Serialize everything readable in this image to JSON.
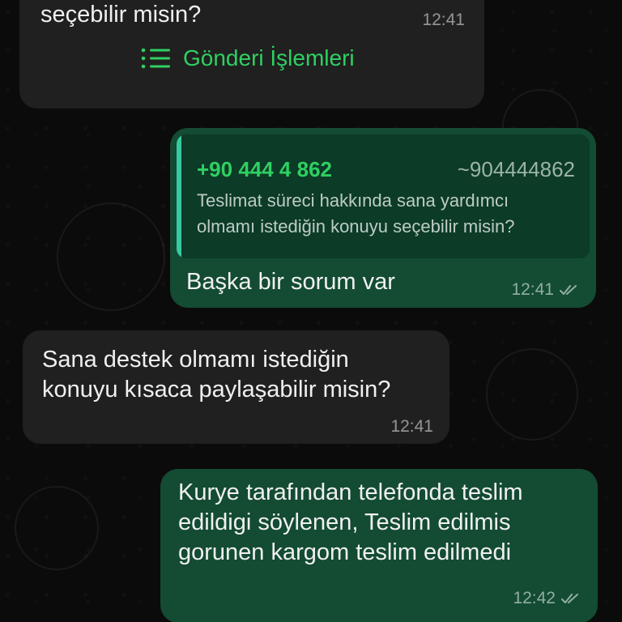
{
  "messages": [
    {
      "direction": "incoming",
      "text": "seçebilir misin?",
      "time": "12:41",
      "action": {
        "icon": "list-icon",
        "label": "Gönderi İşlemleri"
      }
    },
    {
      "direction": "outgoing",
      "quote": {
        "author": "+90 444 4 862",
        "phone": "~904444862",
        "text": "Teslimat süreci hakkında sana yardımcı\nolmamı istediğin konuyu seçebilir misin?"
      },
      "text": "Başka bir sorum var",
      "time": "12:41",
      "status": "double-check-icon"
    },
    {
      "direction": "incoming",
      "text": "Sana destek olmamı istediğin\nkonuyu kısaca paylaşabilir misin?",
      "time": "12:41"
    },
    {
      "direction": "outgoing",
      "text": "Kurye tarafından telefonda teslim\nedildigi söylenen, Teslim edilmis\ngorunen kargom teslim edilmedi",
      "time": "12:42",
      "status": "double-check-icon"
    }
  ],
  "colors": {
    "background": "#0b0b0b",
    "incoming_bubble": "#202020",
    "outgoing_bubble": "#134b33",
    "accent_green": "#2fd062",
    "quote_bar": "#39c9a1"
  }
}
